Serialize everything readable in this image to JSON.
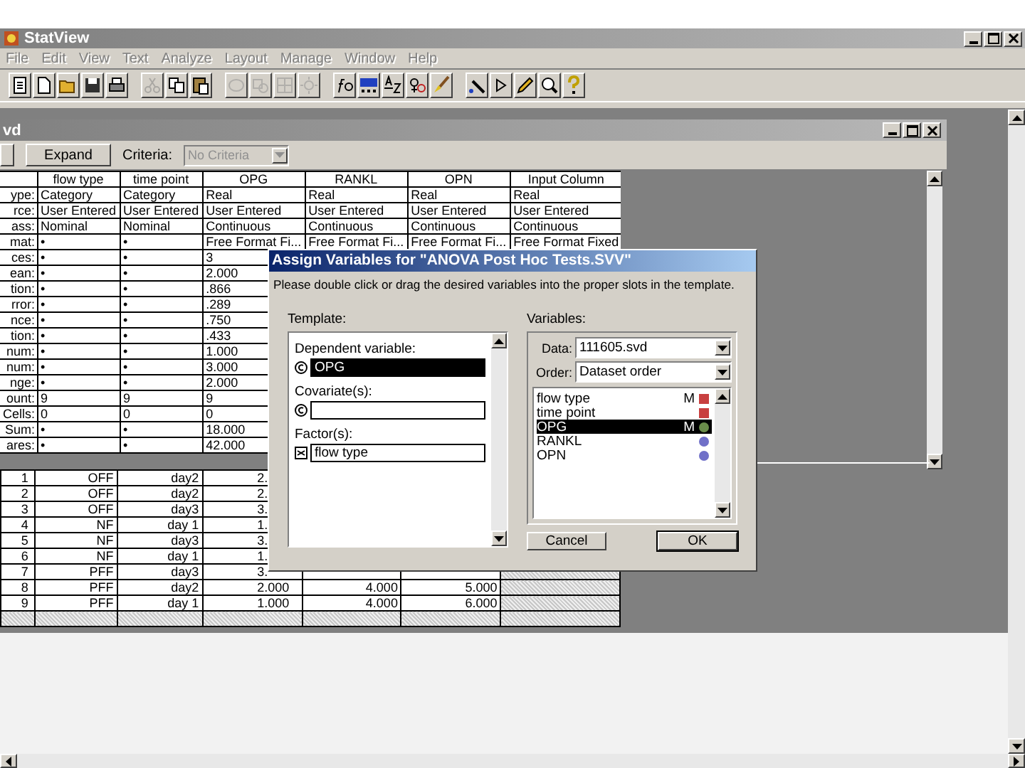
{
  "app": {
    "title": "StatView"
  },
  "menu": [
    "File",
    "Edit",
    "View",
    "Text",
    "Analyze",
    "Layout",
    "Manage",
    "Window",
    "Help"
  ],
  "toolbar": [
    {
      "kind": "new",
      "disabled": false
    },
    {
      "kind": "page",
      "disabled": false
    },
    {
      "kind": "open",
      "disabled": false
    },
    {
      "kind": "save",
      "disabled": false
    },
    {
      "kind": "print",
      "disabled": false
    },
    {
      "kind": "cut",
      "disabled": true
    },
    {
      "kind": "copy",
      "disabled": false
    },
    {
      "kind": "paste",
      "disabled": false
    },
    {
      "kind": "loop",
      "disabled": true
    },
    {
      "kind": "shapes",
      "disabled": true
    },
    {
      "kind": "grid",
      "disabled": true
    },
    {
      "kind": "sun",
      "disabled": true
    },
    {
      "kind": "formula",
      "disabled": false
    },
    {
      "kind": "chart",
      "disabled": false
    },
    {
      "kind": "sort",
      "disabled": false
    },
    {
      "kind": "symbols",
      "disabled": false
    },
    {
      "kind": "brush",
      "disabled": false
    },
    {
      "kind": "line",
      "disabled": false
    },
    {
      "kind": "play",
      "disabled": false
    },
    {
      "kind": "pencil",
      "disabled": false
    },
    {
      "kind": "magnifier",
      "disabled": false
    },
    {
      "kind": "help",
      "disabled": false
    }
  ],
  "document": {
    "title": "vd",
    "expand_button": "Expand",
    "criteria_label": "Criteria:",
    "criteria": {
      "value": "No Criteria",
      "disabled": true
    },
    "columns": [
      "flow type",
      "time point",
      "OPG",
      "RANKL",
      "OPN",
      "Input Column"
    ],
    "attributes": [
      {
        "label": "ype:",
        "cells": [
          "Category",
          "Category",
          "Real",
          "Real",
          "Real",
          "Real"
        ]
      },
      {
        "label": "rce:",
        "cells": [
          "User Entered",
          "User Entered",
          "User Entered",
          "User Entered",
          "User Entered",
          "User Entered"
        ]
      },
      {
        "label": "ass:",
        "cells": [
          "Nominal",
          "Nominal",
          "Continuous",
          "Continuous",
          "Continuous",
          "Continuous"
        ]
      },
      {
        "label": "mat:",
        "cells": [
          "•",
          "•",
          "Free Format Fi...",
          "Free Format Fi...",
          "Free Format Fi...",
          "Free Format Fixed"
        ]
      },
      {
        "label": "ces:",
        "cells": [
          "•",
          "•",
          "3"
        ]
      },
      {
        "label": "ean:",
        "cells": [
          "•",
          "•",
          "2.000"
        ]
      },
      {
        "label": "tion:",
        "cells": [
          "•",
          "•",
          ".866"
        ]
      },
      {
        "label": "rror:",
        "cells": [
          "•",
          "•",
          ".289"
        ]
      },
      {
        "label": "nce:",
        "cells": [
          "•",
          "•",
          ".750"
        ]
      },
      {
        "label": "tion:",
        "cells": [
          "•",
          "•",
          ".433"
        ]
      },
      {
        "label": "num:",
        "cells": [
          "•",
          "•",
          "1.000"
        ]
      },
      {
        "label": "num:",
        "cells": [
          "•",
          "•",
          "3.000"
        ]
      },
      {
        "label": "nge:",
        "cells": [
          "•",
          "•",
          "2.000"
        ]
      },
      {
        "label": "ount:",
        "cells": [
          "9",
          "9",
          "9"
        ]
      },
      {
        "label": "Cells:",
        "cells": [
          "0",
          "0",
          "0"
        ]
      },
      {
        "label": "Sum:",
        "cells": [
          "•",
          "•",
          "18.000"
        ]
      },
      {
        "label": "ares:",
        "cells": [
          "•",
          "•",
          "42.000"
        ]
      }
    ],
    "rows": [
      {
        "index": "1",
        "cells": [
          "OFF",
          "day2",
          "2."
        ]
      },
      {
        "index": "2",
        "cells": [
          "OFF",
          "day2",
          "2."
        ]
      },
      {
        "index": "3",
        "cells": [
          "OFF",
          "day3",
          "3."
        ]
      },
      {
        "index": "4",
        "cells": [
          "NF",
          "day 1",
          "1."
        ]
      },
      {
        "index": "5",
        "cells": [
          "NF",
          "day3",
          "3."
        ]
      },
      {
        "index": "6",
        "cells": [
          "NF",
          "day 1",
          "1."
        ]
      },
      {
        "index": "7",
        "cells": [
          "PFF",
          "day3",
          "3."
        ]
      },
      {
        "index": "8",
        "cells": [
          "PFF",
          "day2",
          "2.000",
          "4.000",
          "5.000"
        ]
      },
      {
        "index": "9",
        "cells": [
          "PFF",
          "day 1",
          "1.000",
          "4.000",
          "6.000"
        ]
      }
    ]
  },
  "dialog": {
    "title": "Assign Variables for \"ANOVA Post Hoc Tests.SVV\"",
    "instruction": "Please double click or drag the desired variables into the proper slots in the template.",
    "template_label": "Template:",
    "slots": [
      {
        "label": "Dependent variable:",
        "kind": "continuous",
        "value": "OPG",
        "selected": true
      },
      {
        "label": "Covariate(s):",
        "kind": "continuous",
        "selected": false
      },
      {
        "label": "Factor(s):",
        "kind": "nominal",
        "value": "flow type",
        "selected": false
      }
    ],
    "variables_label": "Variables:",
    "data": {
      "label": "Data:",
      "value": "111605.svd"
    },
    "order": {
      "label": "Order:",
      "value": "Dataset order"
    },
    "variables": [
      {
        "name": "flow type",
        "marker": "M",
        "kind": "nominal",
        "color": "#c84040",
        "selected": false
      },
      {
        "name": "time point",
        "kind": "nominal",
        "color": "#c84040",
        "selected": false
      },
      {
        "name": "OPG",
        "marker": "M",
        "kind": "continuous",
        "color": "#6a8c4a",
        "selected": true
      },
      {
        "name": "RANKL",
        "kind": "continuous",
        "color": "#7070c8",
        "selected": false
      },
      {
        "name": "OPN",
        "kind": "continuous",
        "color": "#7070c8",
        "selected": false
      }
    ],
    "buttons": [
      {
        "label": "Cancel",
        "default": false
      },
      {
        "label": "OK",
        "default": true
      }
    ]
  }
}
